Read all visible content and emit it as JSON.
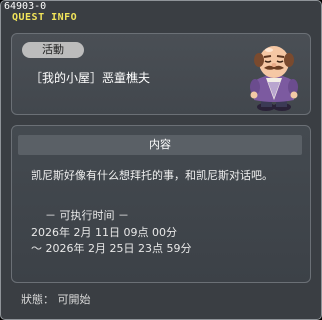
{
  "window": {
    "id_label": "64903-0",
    "title": "QUEST INFO"
  },
  "quest": {
    "category": "活動",
    "name": "［我的小屋］恶童樵夫",
    "npc_icon": "npc-portrait-old-man"
  },
  "content": {
    "header": "内容",
    "description": "凯尼斯好像有什么想拜托的事，和凯尼斯对话吧。",
    "time_label": "－ 可执行时间 －",
    "time_start": "2026年 2月 11日 09点 00分",
    "time_end": "～ 2026年 2月 25日 23点 59分"
  },
  "status": {
    "text": "狀態： 可開始"
  },
  "colors": {
    "title": "#f1e45a",
    "panel": "#3a3e43",
    "pill": "#bcbcbc"
  }
}
